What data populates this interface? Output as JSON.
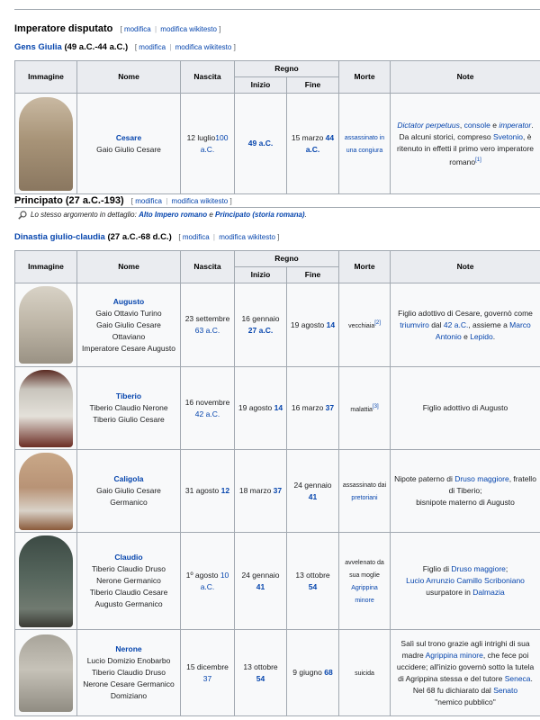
{
  "disputed": {
    "heading": "Imperatore disputato",
    "edit": {
      "open": "[",
      "modifica": "modifica",
      "sep": "|",
      "modifica_wikitesto": "modifica wikitesto",
      "close": "]"
    }
  },
  "gens": {
    "name": "Gens Giulia",
    "dates": "(49 a.C.-44 a.C.)"
  },
  "columns": {
    "immagine": "Immagine",
    "nome": "Nome",
    "nascita": "Nascita",
    "regno": "Regno",
    "inizio": "Inizio",
    "fine": "Fine",
    "morte": "Morte",
    "note": "Note"
  },
  "cesare": {
    "name": "Cesare",
    "full": "Gaio Giulio Cesare",
    "birth_day": "12 luglio",
    "birth_year": "100 a.C.",
    "start": "49 a.C.",
    "end_day": "15 marzo",
    "end_year": "44 a.C.",
    "death": "assassinato in una congiura",
    "note_a": "Dictator perpetuus",
    "note_b": ", ",
    "note_c": "console",
    "note_d": " e ",
    "note_e": "imperator",
    "note_f": ". Da alcuni storici, compreso ",
    "note_g": "Svetonio",
    "note_h": ", è ritenuto in effetti il primo vero imperatore romano",
    "note_ref": "[1]"
  },
  "principato": {
    "heading": "Principato",
    "dates": "(27 a.C.-193)",
    "hatnote_a": "Lo stesso argomento in dettaglio: ",
    "hatnote_b": "Alto Impero romano",
    "hatnote_c": " e ",
    "hatnote_d": "Principato (storia romana)",
    "hatnote_e": "."
  },
  "dinastia": {
    "name": "Dinastia giulio-claudia",
    "dates": "(27 a.C.-68 d.C.)"
  },
  "rows": [
    {
      "name": "Augusto",
      "full": [
        "Gaio Ottavio Turino",
        "Gaio Giulio Cesare Ottaviano",
        "Imperatore Cesare Augusto"
      ],
      "birth_day": "23 settembre",
      "birth_year": "63 a.C.",
      "start_day": "16 gennaio",
      "start_year": "27 a.C.",
      "end_day": "19 agosto",
      "end_year": "14",
      "death": "vecchiaia",
      "death_ref": "[2]",
      "note": [
        "Figlio adottivo di Cesare, governò come ",
        "triumviro",
        " dal ",
        "42 a.C.",
        ", assieme a ",
        "Marco Antonio",
        " e ",
        "Lepido",
        "."
      ]
    },
    {
      "name": "Tiberio",
      "full": [
        "Tiberio Claudio Nerone",
        "Tiberio Giulio Cesare"
      ],
      "birth_day": "16 novembre",
      "birth_year": "42 a.C.",
      "start_day": "19 agosto",
      "start_year": "14",
      "end_day": "16 marzo",
      "end_year": "37",
      "death": "malattia",
      "death_ref": "[3]",
      "note": [
        "Figlio adottivo di Augusto"
      ]
    },
    {
      "name": "Caligola",
      "full": [
        "Gaio Giulio Cesare Germanico"
      ],
      "birth_day": "31 agosto",
      "birth_year": "12",
      "start_day": "18 marzo",
      "start_year": "37",
      "end_day": "24 gennaio",
      "end_year": "41",
      "death": "assassinato dai",
      "death_link": "pretoriani",
      "note": [
        "Nipote paterno di ",
        "Druso maggiore",
        ", fratello di Tiberio;",
        "bisnipote materno di Augusto"
      ]
    },
    {
      "name": "Claudio",
      "full": [
        "Tiberio Claudio Druso Nerone Germanico",
        "Tiberio Claudio Cesare Augusto Germanico"
      ],
      "birth_day": "1º agosto",
      "birth_year": "10 a.C.",
      "start_day": "24 gennaio",
      "start_year": "41",
      "end_day": "13 ottobre",
      "end_year": "54",
      "death": "avvelenato da sua moglie",
      "death_link": "Agrippina minore",
      "note": [
        "Figlio di ",
        "Druso maggiore",
        ";",
        "Lucio Arrunzio Camillo Scriboniano",
        "usurpatore in ",
        "Dalmazia"
      ]
    },
    {
      "name": "Nerone",
      "full": [
        "Lucio Domizio Enobarbo",
        "Tiberio Claudio Druso Nerone Cesare Germanico",
        "Domiziano"
      ],
      "birth_day": "15 dicembre",
      "birth_year": "37",
      "start_day": "13 ottobre",
      "start_year": "54",
      "end_day": "9 giugno",
      "end_year": "68",
      "death": "suicida",
      "note": [
        "Salì sul trono grazie agli intrighi di sua madre ",
        "Agrippina minore",
        ", che fece poi uccidere; all'inizio governò sotto la tutela di Agrippina stessa e del tutore ",
        "Seneca",
        ". Nel 68 fu dichiarato dal ",
        "Senato",
        "\"nemico pubblico\""
      ]
    }
  ],
  "colors": {
    "link": "#0645ad",
    "header_bg": "#eaecf0",
    "cell_bg": "#f8f9fa",
    "border": "#a2a9b1"
  }
}
